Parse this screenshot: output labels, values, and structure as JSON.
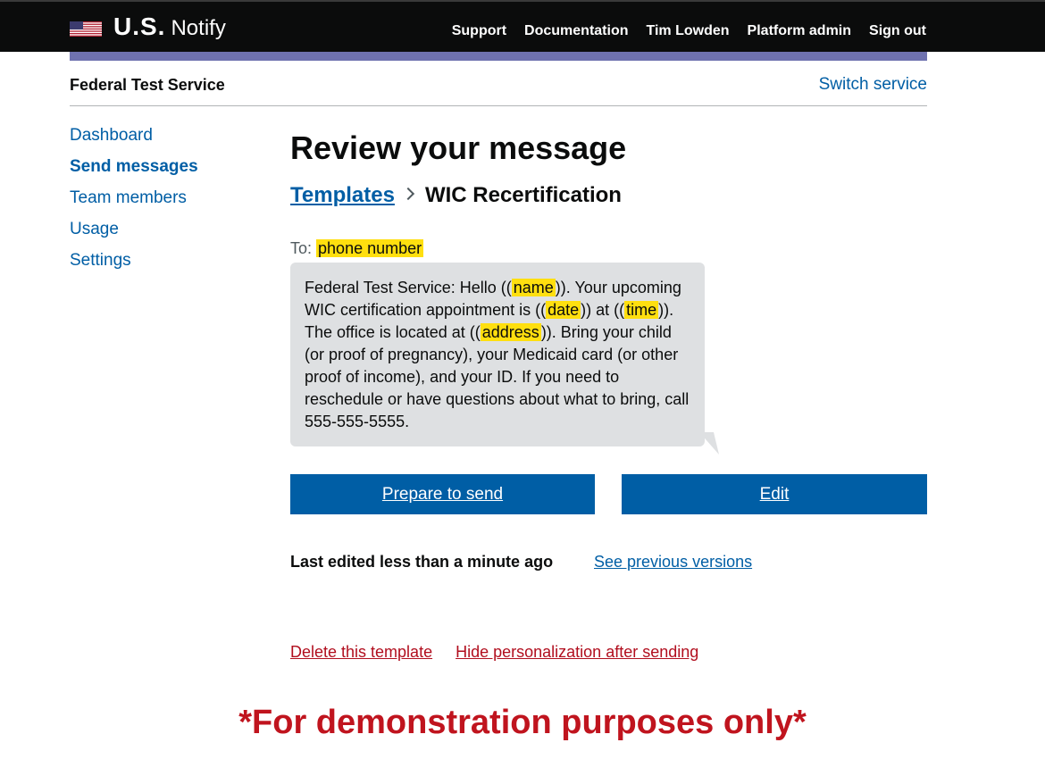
{
  "header": {
    "brand_bold": "U.S.",
    "brand_light": "Notify",
    "nav": [
      "Support",
      "Documentation",
      "Tim Lowden",
      "Platform admin",
      "Sign out"
    ],
    "colors": {
      "bar": "#0b0c0c",
      "phase": "#6f72af"
    }
  },
  "service": {
    "name": "Federal Test Service",
    "switch_label": "Switch service"
  },
  "sidebar": {
    "items": [
      {
        "label": "Dashboard",
        "active": false
      },
      {
        "label": "Send messages",
        "active": true
      },
      {
        "label": "Team members",
        "active": false
      },
      {
        "label": "Usage",
        "active": false
      },
      {
        "label": "Settings",
        "active": false
      }
    ]
  },
  "main": {
    "title": "Review your message",
    "breadcrumb": {
      "link": "Templates",
      "current": "WIC Recertification"
    },
    "to_label": "To:",
    "to_placeholder": "phone number",
    "message": {
      "p1": "Federal Test Service: Hello ((",
      "v1": "name",
      "p2": ")). Your upcoming WIC certification appointment is ((",
      "v2": "date",
      "p3": ")) at ((",
      "v3": "time",
      "p4": ")). The office is located at ((",
      "v4": "address",
      "p5": ")). Bring your child (or proof of pregnancy), your Medicaid card (or other proof of income), and your ID. If you need to reschedule or have questions about what to bring, call 555-555-5555."
    },
    "buttons": {
      "prepare": "Prepare to send",
      "edit": "Edit"
    },
    "last_edited": "Last edited less than a minute ago",
    "previous_versions": "See previous versions",
    "delete_link": "Delete this template",
    "hide_link": "Hide personalization after sending",
    "colors": {
      "link": "#005ea5",
      "button": "#005ea5",
      "danger": "#b10e1e",
      "highlight": "#ffdf0f",
      "bubble": "#dee0e2"
    }
  },
  "footer": {
    "demo_text": "*For demonstration purposes only*"
  }
}
